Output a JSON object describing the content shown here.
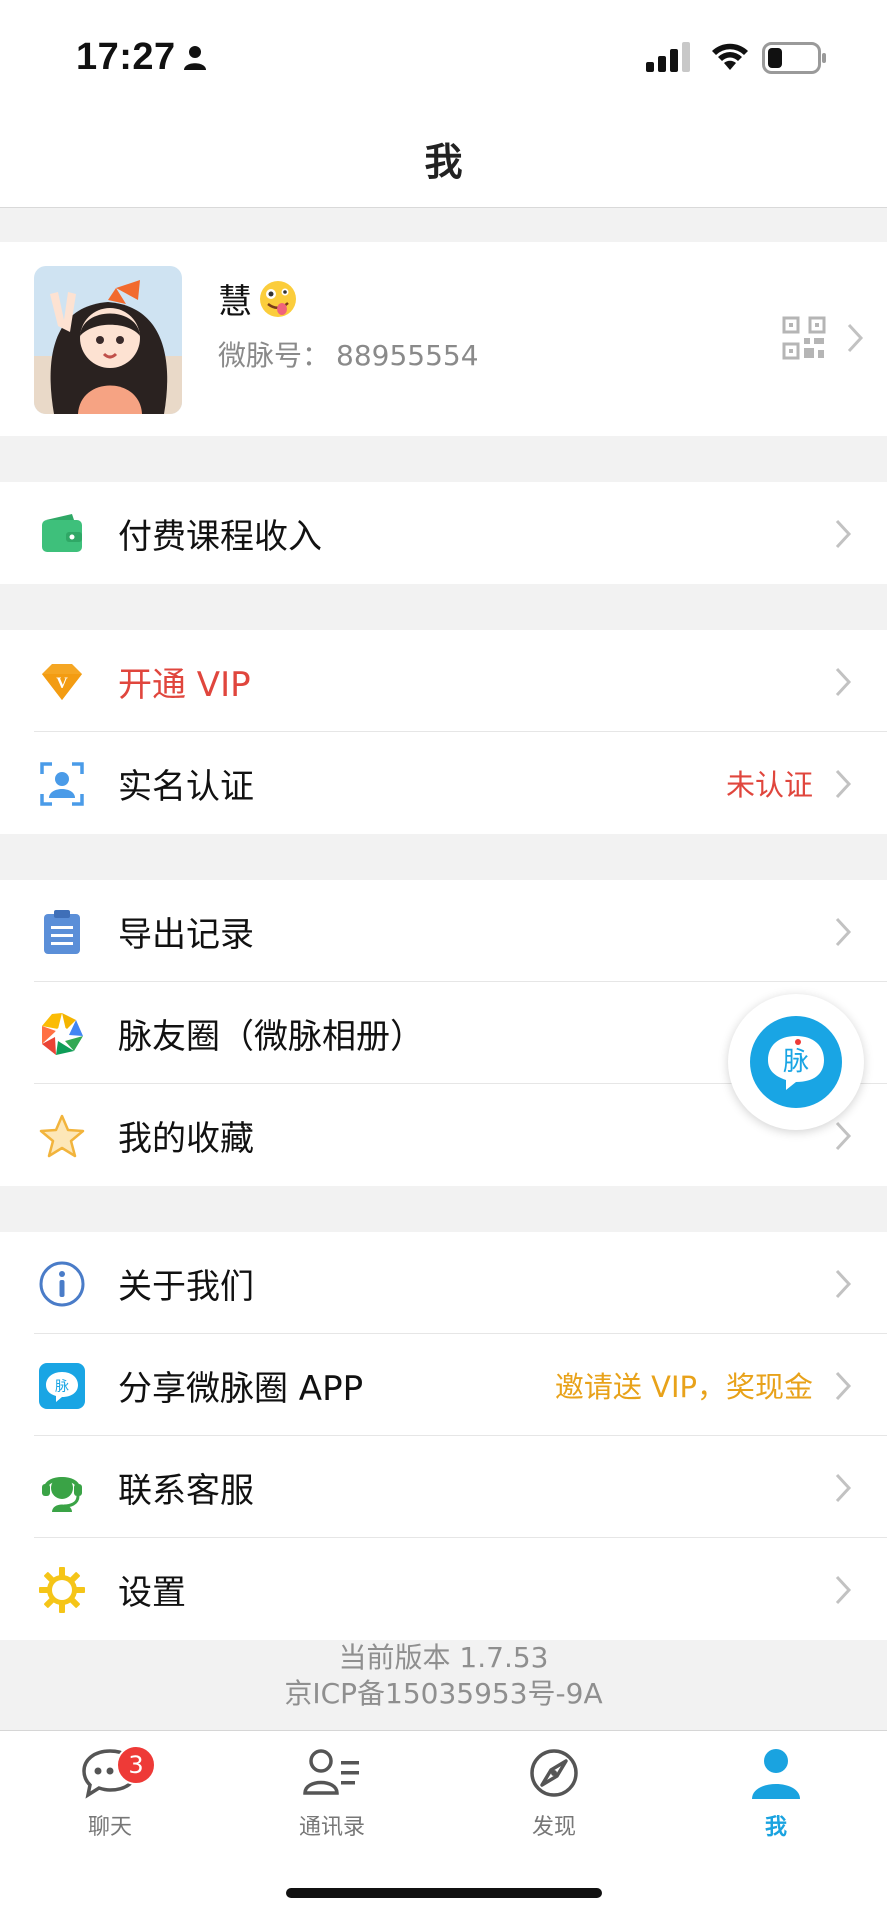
{
  "status_bar": {
    "time": "17:27"
  },
  "nav": {
    "title": "我"
  },
  "profile": {
    "name": "慧",
    "id_label": "微脉号：",
    "id_value": "88955554"
  },
  "menu": {
    "paid_course_income": "付费课程收入",
    "vip": "开通 VIP",
    "real_name": "实名认证",
    "real_name_status": "未认证",
    "export_records": "导出记录",
    "moments": "脉友圈（微脉相册）",
    "favorites": "我的收藏",
    "about": "关于我们",
    "share_app": "分享微脉圈 APP",
    "share_promo": "邀请送 VIP，奖现金",
    "customer_service": "联系客服",
    "settings": "设置"
  },
  "colors": {
    "accent_blue": "#1aa3e0",
    "vip_red": "#e0463d",
    "unverified_red": "#e0463d",
    "promo_orange": "#e8a21a"
  },
  "footer": {
    "version": "当前版本 1.7.53",
    "icp": "京ICP备15035953号-9A"
  },
  "float_button": {
    "label": "脉"
  },
  "tabs": [
    {
      "label": "聊天",
      "badge": "3",
      "icon": "chat-icon"
    },
    {
      "label": "通讯录",
      "icon": "contacts-icon"
    },
    {
      "label": "发现",
      "icon": "discover-icon"
    },
    {
      "label": "我",
      "icon": "me-icon"
    }
  ]
}
